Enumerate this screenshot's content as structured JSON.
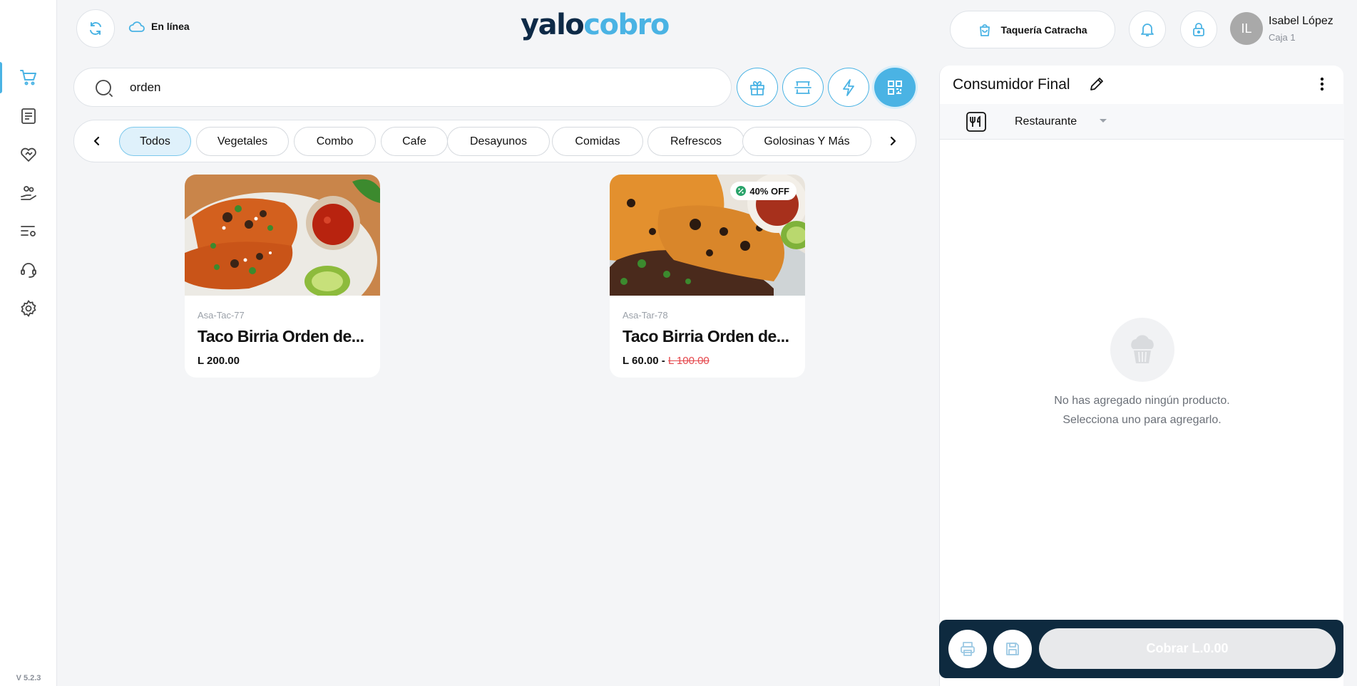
{
  "app": {
    "logo_part1": "yalo",
    "logo_part2": "cobro",
    "version": "V 5.2.3",
    "status": "En línea"
  },
  "colors": {
    "accent": "#4ab3e4",
    "navy": "#0e2a47",
    "footer": "#0e2a3f",
    "discount": "#e5484d"
  },
  "sidebar": {
    "items": [
      {
        "icon": "cart-icon",
        "active": true
      },
      {
        "icon": "orders-icon",
        "active": false
      },
      {
        "icon": "loyalty-heart-icon",
        "active": false
      },
      {
        "icon": "customers-icon",
        "active": false
      },
      {
        "icon": "settings-list-icon",
        "active": false
      },
      {
        "icon": "support-headset-icon",
        "active": false
      },
      {
        "icon": "gear-icon",
        "active": false
      }
    ]
  },
  "header": {
    "store": "Taquería Catracha",
    "user_initials": "IL",
    "user_name": "Isabel López",
    "user_register": "Caja 1"
  },
  "search": {
    "value": "orden",
    "placeholder": ""
  },
  "toolbar": {
    "icons": [
      "gift-icon",
      "barcode-scan-icon",
      "lightning-icon",
      "grid-view-icon"
    ]
  },
  "categories": [
    {
      "label": "Todos",
      "active": true
    },
    {
      "label": "Vegetales",
      "active": false
    },
    {
      "label": "Combo",
      "active": false
    },
    {
      "label": "Cafe",
      "active": false
    },
    {
      "label": "Desayunos",
      "active": false
    },
    {
      "label": "Comidas",
      "active": false
    },
    {
      "label": "Refrescos",
      "active": false
    },
    {
      "label": "Golosinas Y Más",
      "active": false
    }
  ],
  "products": [
    {
      "sku": "Asa-Tac-77",
      "name": "Taco Birria Orden de...",
      "price": "L 200.00",
      "old_price": "",
      "badge": ""
    },
    {
      "sku": "Asa-Tar-78",
      "name": "Taco Birria Orden de...",
      "price": "L 60.00 -",
      "old_price": "L 100.00",
      "badge": "40% OFF"
    }
  ],
  "order": {
    "customer": "Consumidor Final",
    "type": "Restaurante",
    "empty_line1": "No has agregado ningún producto.",
    "empty_line2": "Selecciona uno para agregarlo.",
    "charge_label": "Cobrar L.0.00"
  }
}
